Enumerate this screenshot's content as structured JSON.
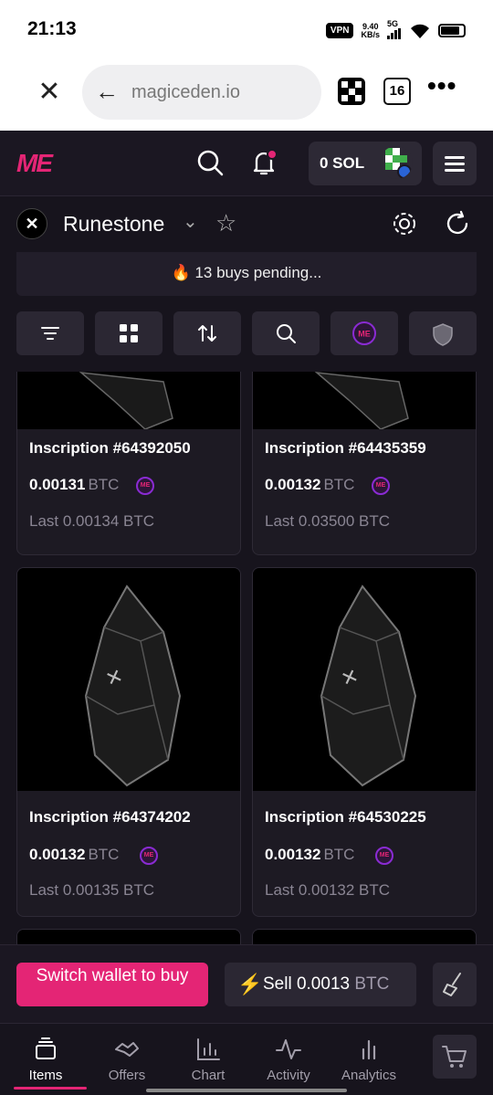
{
  "status": {
    "time": "21:13",
    "vpn": "VPN",
    "speed_value": "9.40",
    "speed_unit": "KB/s",
    "network": "5G"
  },
  "browser": {
    "url": "magiceden.io",
    "tab_count": "16"
  },
  "header": {
    "logo": "ME",
    "wallet_balance": "0 SOL"
  },
  "collection": {
    "name": "Runestone"
  },
  "banner": {
    "emoji": "🔥",
    "text": "13 buys pending..."
  },
  "cards": [
    {
      "name": "Inscription #64392050",
      "price": "0.00131",
      "currency": "BTC",
      "last": "Last 0.00134 BTC"
    },
    {
      "name": "Inscription #64435359",
      "price": "0.00132",
      "currency": "BTC",
      "last": "Last 0.03500 BTC"
    },
    {
      "name": "Inscription #64374202",
      "price": "0.00132",
      "currency": "BTC",
      "last": "Last 0.00135 BTC"
    },
    {
      "name": "Inscription #64530225",
      "price": "0.00132",
      "currency": "BTC",
      "last": "Last 0.00132 BTC"
    }
  ],
  "actions": {
    "buy_label": "Switch wallet to buy",
    "sell_label": "Sell 0.0013",
    "sell_currency": "BTC"
  },
  "nav": [
    {
      "label": "Items"
    },
    {
      "label": "Offers"
    },
    {
      "label": "Chart"
    },
    {
      "label": "Activity"
    },
    {
      "label": "Analytics"
    }
  ],
  "colors": {
    "accent": "#e42575",
    "background": "#17141d",
    "card": "#1d1a23"
  }
}
